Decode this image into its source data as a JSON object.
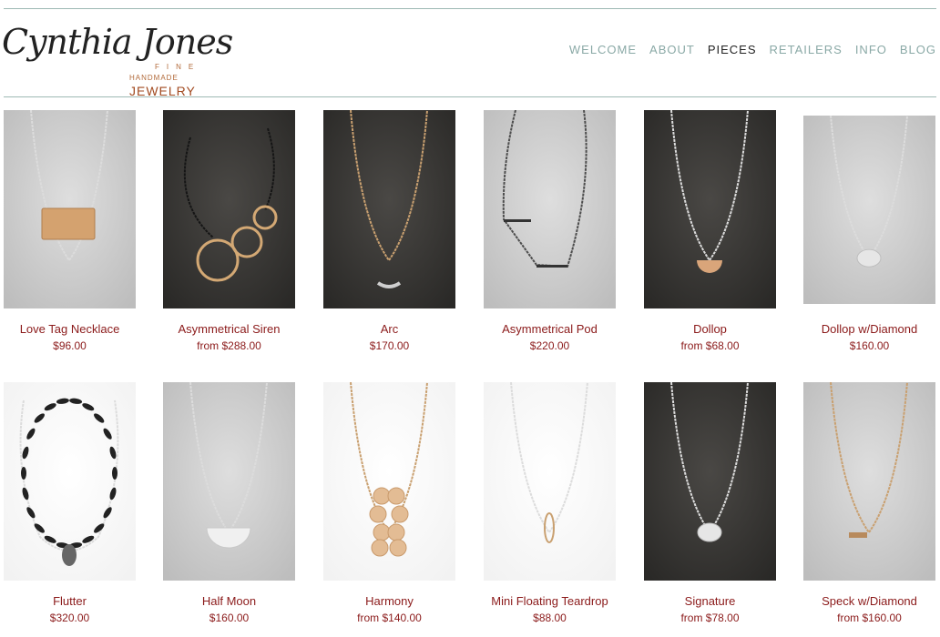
{
  "logo": {
    "script_text": "Cynthia Jones",
    "line_fine": "FINE",
    "line_handmade": "HANDMADE",
    "line_jewelry": "JEWELRY"
  },
  "nav": {
    "items": [
      {
        "label": "WELCOME"
      },
      {
        "label": "ABOUT"
      },
      {
        "label": "PIECES",
        "active": true
      },
      {
        "label": "RETAILERS"
      },
      {
        "label": "INFO"
      },
      {
        "label": "BLOG"
      }
    ]
  },
  "products": [
    {
      "name": "Love Tag Necklace",
      "price": "$96.00",
      "bg": "light",
      "chain": "silver",
      "pendant": "gold-bar"
    },
    {
      "name": "Asymmetrical Siren",
      "price": "from $288.00",
      "bg": "dark",
      "chain": "black",
      "pendant": "rings"
    },
    {
      "name": "Arc",
      "price": "$170.00",
      "bg": "dark",
      "chain": "gold",
      "pendant": "arc"
    },
    {
      "name": "Asymmetrical Pod",
      "price": "$220.00",
      "bg": "light",
      "chain": "gunmetal",
      "pendant": "bars"
    },
    {
      "name": "Dollop",
      "price": "from $68.00",
      "bg": "dark",
      "chain": "silver",
      "pendant": "gold-half"
    },
    {
      "name": "Dollop w/Diamond",
      "price": "$160.00",
      "bg": "light",
      "chain": "silver",
      "pendant": "silver-disc"
    },
    {
      "name": "Flutter",
      "price": "$320.00",
      "bg": "white",
      "chain": "silver",
      "pendant": "leaves"
    },
    {
      "name": "Half Moon",
      "price": "$160.00",
      "bg": "light",
      "chain": "silver",
      "pendant": "silver-half"
    },
    {
      "name": "Harmony",
      "price": "from $140.00",
      "bg": "white",
      "chain": "gold",
      "pendant": "discs"
    },
    {
      "name": "Mini Floating Teardrop",
      "price": "$88.00",
      "bg": "white",
      "chain": "silver",
      "pendant": "teardrop"
    },
    {
      "name": "Signature",
      "price": "from $78.00",
      "bg": "dark",
      "chain": "silver",
      "pendant": "silver-disc"
    },
    {
      "name": "Speck w/Diamond",
      "price": "from $160.00",
      "bg": "light",
      "chain": "gold",
      "pendant": "gold-bar-small"
    }
  ],
  "colors": {
    "nav_inactive": "#8aa9a6",
    "nav_active": "#222222",
    "product_text": "#8b1a1a",
    "rule": "#9db9b4",
    "logo_accent": "#a24a20"
  }
}
